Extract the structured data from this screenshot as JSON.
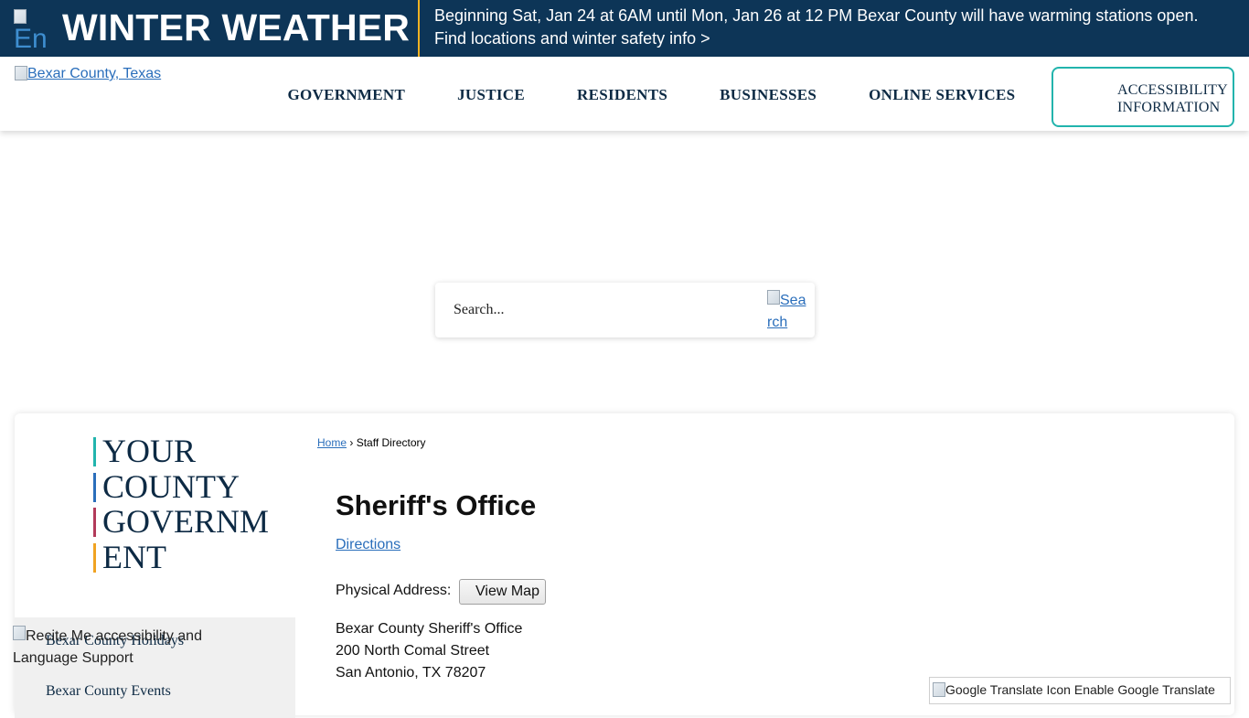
{
  "alert": {
    "image_alt": "En",
    "title": "WINTER WEATHER",
    "line1": "Beginning Sat, Jan 24 at 6AM until Mon, Jan 26 at 12 PM Bexar County will have warming stations open.",
    "line2": "Find locations and winter safety info >",
    "colors": {
      "background": "#0d3557",
      "divider": "#f0b323"
    }
  },
  "header": {
    "logo_alt": "Bexar County, Texas",
    "nav": [
      "GOVERNMENT",
      "JUSTICE",
      "RESIDENTS",
      "BUSINESSES",
      "ONLINE SERVICES"
    ],
    "accessibility_line1": "ACCESSIBILITY",
    "accessibility_line2": "INFORMATION",
    "colors": {
      "nav_text": "#0d2a44",
      "accessibility_border": "#22b4ad"
    }
  },
  "search": {
    "placeholder": "Search...",
    "button_alt": "Search"
  },
  "sidebar": {
    "heading": [
      "YOUR",
      "COUNTY",
      "GOVERNM",
      "ENT"
    ],
    "accent_colors": [
      "#22b4ad",
      "#2a6ebb",
      "#b23a5a",
      "#f0a322"
    ],
    "menu": [
      "Bexar County Holidays",
      "Bexar County Events"
    ]
  },
  "recite": {
    "alt": "Recite Me accessibility and Language Support"
  },
  "breadcrumb": {
    "home": "Home",
    "separator": "›",
    "current": "Staff Directory"
  },
  "main": {
    "title": "Sheriff's Office",
    "directions": "Directions",
    "physical_address_label": "Physical Address:",
    "view_map": "View Map",
    "address": [
      "Bexar County Sheriff's Office",
      "200 North Comal Street",
      "San Antonio, TX 78207"
    ]
  },
  "translate": {
    "label": "Google Translate Icon Enable Google Translate"
  }
}
